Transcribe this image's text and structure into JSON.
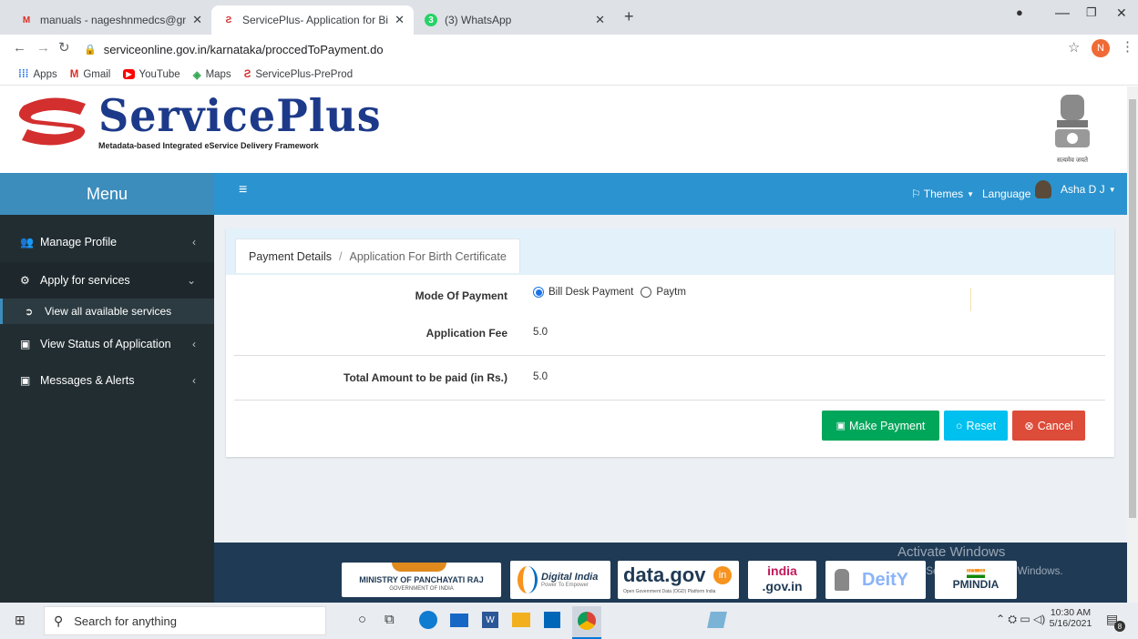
{
  "browser": {
    "tabs": [
      {
        "title": "manuals - nageshnmedcs@gmai",
        "icon": "gmail-icon"
      },
      {
        "title": "ServicePlus- Application for Birth",
        "icon": "serviceplus-icon"
      },
      {
        "title": "(3) WhatsApp",
        "icon": "whatsapp-icon"
      }
    ],
    "new_tab": "+",
    "url": "serviceonline.gov.in/karnataka/proccedToPayment.do",
    "profile_initial": "N",
    "bookmarks": [
      {
        "label": "Apps",
        "icon": "apps-icon"
      },
      {
        "label": "Gmail",
        "icon": "gmail-icon"
      },
      {
        "label": "YouTube",
        "icon": "youtube-icon"
      },
      {
        "label": "Maps",
        "icon": "maps-icon"
      },
      {
        "label": "ServicePlus-PreProd",
        "icon": "serviceplus-icon"
      }
    ]
  },
  "header": {
    "logo_text": "ServicePlus",
    "logo_subtitle": "Metadata-based Integrated eService Delivery Framework",
    "emblem_caption": "सत्यमेव जयते"
  },
  "topbar": {
    "menu_label": "Menu",
    "themes": "Themes",
    "language": "Language",
    "user": "Asha D J"
  },
  "sidebar": {
    "items": [
      {
        "label": "Manage Profile"
      },
      {
        "label": "Apply for services"
      },
      {
        "label": "View all available services"
      },
      {
        "label": "View Status of Application"
      },
      {
        "label": "Messages & Alerts"
      }
    ]
  },
  "breadcrumb": {
    "first": "Payment Details",
    "sep": "/",
    "second": "Application For Birth Certificate"
  },
  "form": {
    "mode_label": "Mode Of Payment",
    "option1": "Bill Desk Payment",
    "option2": "Paytm",
    "fee_label": "Application Fee",
    "fee_value": "5.0",
    "total_label": "Total Amount to be paid (in Rs.)",
    "total_value": "5.0"
  },
  "buttons": {
    "make_payment": "Make Payment",
    "reset": "Reset",
    "cancel": "Cancel"
  },
  "footer": {
    "panchayati": "MINISTRY OF PANCHAYATI RAJ",
    "panchayati_sub": "GOVERNMENT OF INDIA",
    "digital_india": "Digital India",
    "digital_india_sub": "Power To Empower",
    "datagov": "data.gov",
    "datagov_sub": "Open Government Data (OGD) Platform India",
    "indiagov_top": "india",
    "indiagov_bottom": ".gov.in",
    "dept": "DeitY",
    "pmindia": "PMINDIA",
    "activate_title": "Activate Windows",
    "activate_sub": "Go to Settings to activate Windows."
  },
  "taskbar": {
    "search": "Search for anything",
    "time": "10:30 AM",
    "date": "5/16/2021",
    "notif_count": "8"
  },
  "colors": {
    "primary": "#3c8dbc",
    "sidebar": "#222d32",
    "success": "#00a65a",
    "info": "#00c0ef",
    "danger": "#dd4b39"
  }
}
